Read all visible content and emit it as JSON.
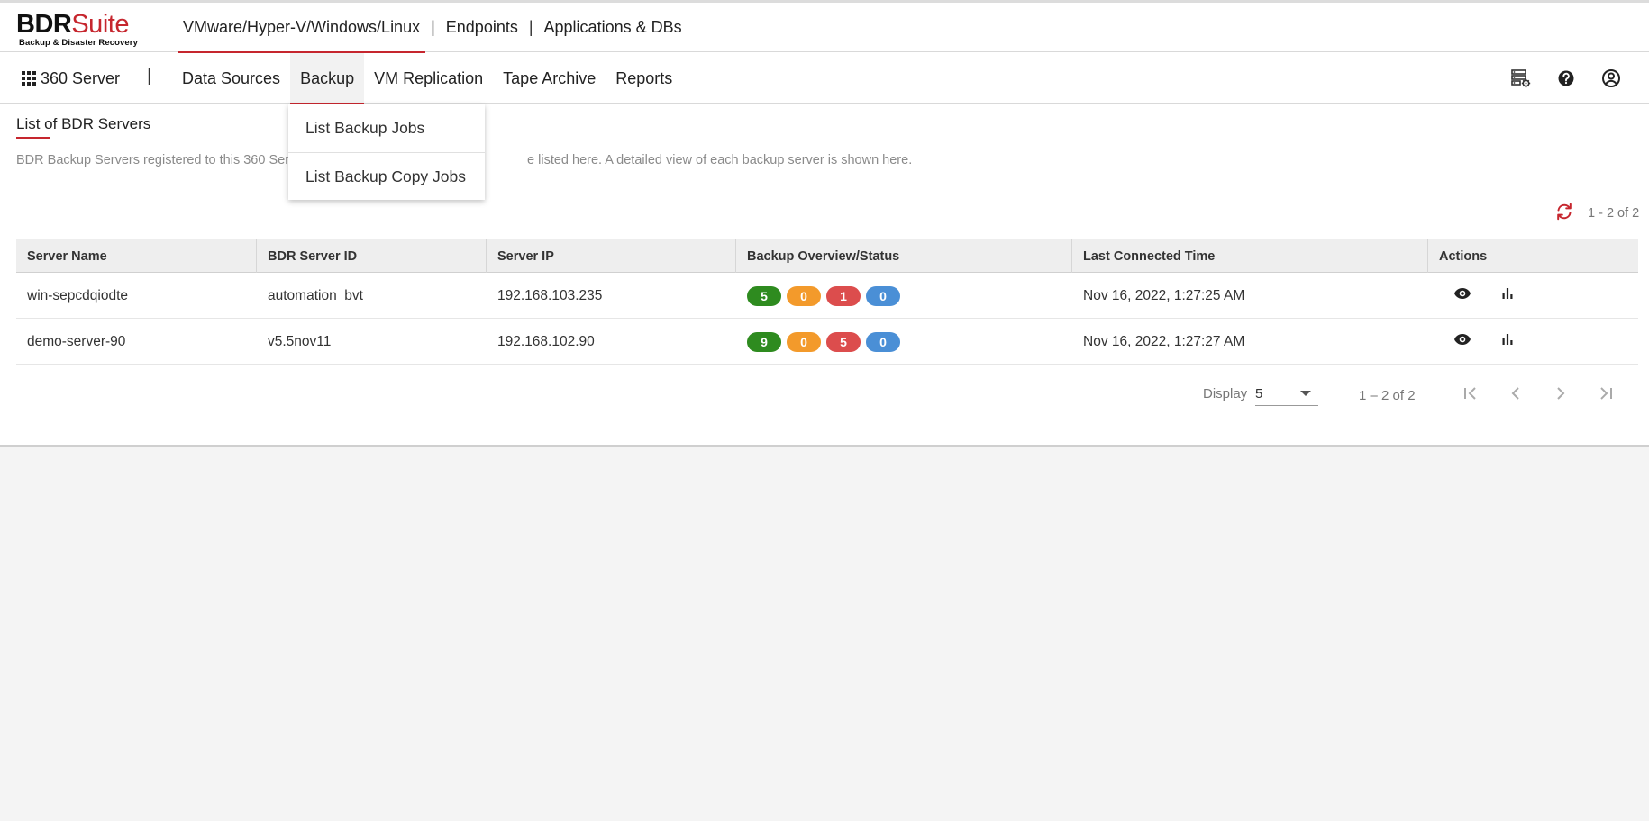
{
  "brand": {
    "name_bold": "BDR",
    "name_light": "Suite",
    "tagline": "Backup & Disaster Recovery"
  },
  "product_tabs": [
    {
      "label": "VMware/Hyper-V/Windows/Linux",
      "active": true
    },
    {
      "label": "Endpoints",
      "active": false
    },
    {
      "label": "Applications & DBs",
      "active": false
    }
  ],
  "app_switch": {
    "label": "360 Server",
    "icon": "grid-icon"
  },
  "nav_separator": "|",
  "product_separator": "|",
  "nav": [
    {
      "label": "Data Sources",
      "active": false
    },
    {
      "label": "Backup",
      "active": true
    },
    {
      "label": "VM Replication",
      "active": false
    },
    {
      "label": "Tape Archive",
      "active": false
    },
    {
      "label": "Reports",
      "active": false
    }
  ],
  "header_icons": [
    "server-settings-icon",
    "help-icon",
    "user-account-icon"
  ],
  "dropdown": {
    "items": [
      "List Backup Jobs",
      "List Backup Copy Jobs"
    ]
  },
  "page": {
    "title": "List of BDR Servers",
    "description_start": "BDR Backup Servers registered to this 360 Ser",
    "description_end": "e listed here. A detailed view of each backup server is shown here."
  },
  "count_top": "1 - 2 of 2",
  "table": {
    "columns": [
      "Server Name",
      "BDR Server ID",
      "Server IP",
      "Backup Overview/Status",
      "Last Connected Time",
      "Actions"
    ],
    "rows": [
      {
        "server_name": "win-sepcdqiodte",
        "server_id": "automation_bvt",
        "server_ip": "192.168.103.235",
        "status": [
          "5",
          "0",
          "1",
          "0"
        ],
        "last_connected": "Nov 16, 2022, 1:27:25 AM"
      },
      {
        "server_name": "demo-server-90",
        "server_id": "v5.5nov11",
        "server_ip": "192.168.102.90",
        "status": [
          "9",
          "0",
          "5",
          "0"
        ],
        "last_connected": "Nov 16, 2022, 1:27:27 AM"
      }
    ]
  },
  "status_colors": [
    "#2e8b1f",
    "#f39a2b",
    "#dc4d4d",
    "#4a8fd6"
  ],
  "accent_color": "#c6262e",
  "pagination": {
    "display_label": "Display",
    "page_size": "5",
    "range": "1 – 2 of 2"
  }
}
